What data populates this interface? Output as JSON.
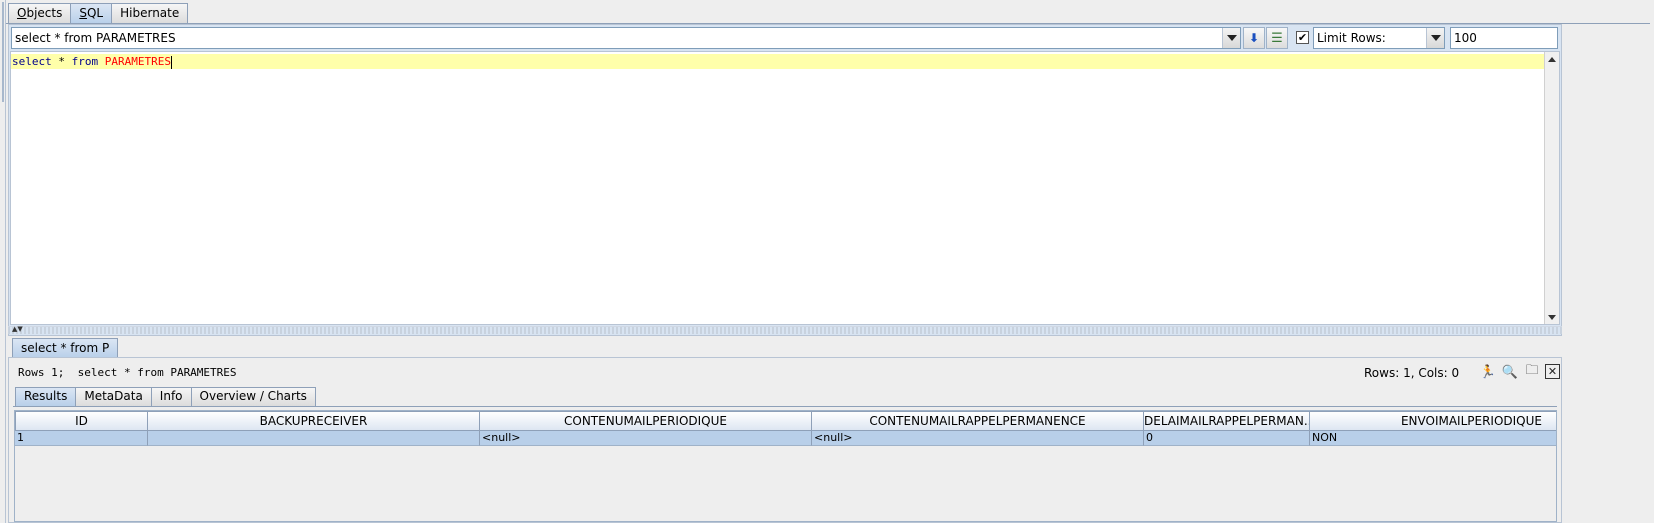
{
  "top_tabs": [
    {
      "label": "Objects",
      "mnemonic": "O",
      "rest": "bjects",
      "active": false
    },
    {
      "label": "SQL",
      "mnemonic": "S",
      "rest": "QL",
      "active": true
    },
    {
      "label": "Hibernate",
      "active": false
    }
  ],
  "query_bar": {
    "history_value": "select * from PARAMETRES",
    "limit_rows_checked": true,
    "limit_rows_label": "Limit Rows:",
    "limit_rows_value": "100"
  },
  "editor": {
    "keyword_1": "select",
    "star": " * ",
    "keyword_2": "from",
    "space": " ",
    "table": "PARAMETRES"
  },
  "result_tab": {
    "label": "select * from P"
  },
  "results": {
    "status": "Rows 1;  select * from PARAMETRES",
    "rows_cols": "Rows: 1, Cols: 0",
    "sub_tabs": [
      "Results",
      "MetaData",
      "Info",
      "Overview / Charts"
    ],
    "columns": [
      "ID",
      "BACKUPRECEIVER",
      "CONTENUMAILPERIODIQUE",
      "CONTENUMAILRAPPELPERMANENCE",
      "DELAIMAILRAPPELPERMAN...",
      "ENVOIMAILPERIODIQUE"
    ],
    "rows": [
      [
        "1",
        "",
        "<null>",
        "<null>",
        "0",
        "NON"
      ]
    ]
  },
  "colors": {
    "current_line": "#ffffaa",
    "sql_keyword": "#00008b",
    "sql_table": "#ff0000",
    "selected_row": "#b8cfe9"
  }
}
